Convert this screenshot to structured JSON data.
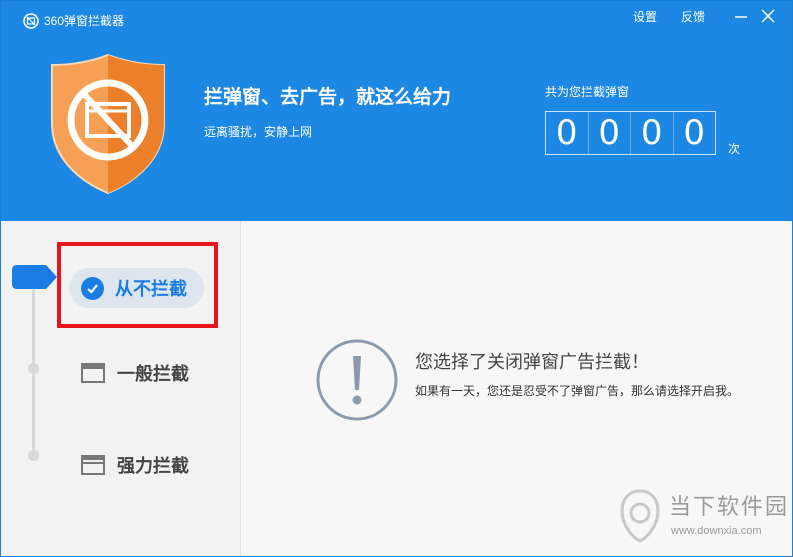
{
  "app": {
    "title": "360弹窗拦截器"
  },
  "title_bar": {
    "settings": "设置",
    "feedback": "反馈"
  },
  "header": {
    "headline": "拦弹窗、去广告，就这么给力",
    "subline": "远离骚扰，安静上网"
  },
  "counter": {
    "label": "共为您拦截弹窗",
    "digits": [
      "0",
      "0",
      "0",
      "0"
    ],
    "unit": "次"
  },
  "modes": [
    {
      "label": "从不拦截",
      "selected": true,
      "icon": "check-circle-icon"
    },
    {
      "label": "一般拦截",
      "selected": false,
      "icon": "window-icon"
    },
    {
      "label": "强力拦截",
      "selected": false,
      "icon": "window-stack-icon"
    }
  ],
  "main": {
    "title": "您选择了关闭弹窗广告拦截！",
    "description": "如果有一天，您还是忍受不了弹窗广告，那么请选择开启我。"
  },
  "watermark": {
    "text": "当下软件园",
    "url": "www.downxia.com"
  },
  "colors": {
    "header_bg": "#1d87e4",
    "accent": "#1a7de3",
    "shield_orange": "#f08a30",
    "highlight_red": "#e8141b"
  }
}
